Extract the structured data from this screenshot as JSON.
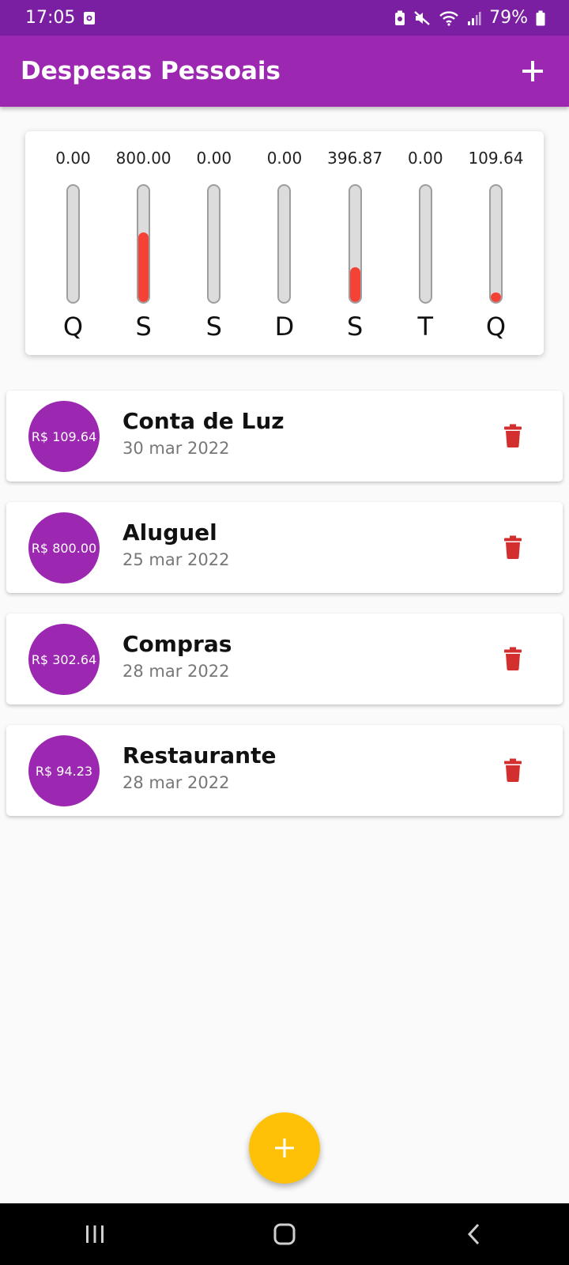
{
  "status_bar": {
    "time": "17:05",
    "battery": "79%",
    "icons": [
      "screen-record-icon",
      "battery-saver-icon",
      "mute-icon",
      "wifi-icon",
      "signal-icon",
      "battery-icon"
    ]
  },
  "app_bar": {
    "title": "Despesas Pessoais",
    "add_icon": "plus-icon"
  },
  "colors": {
    "primary": "#9c27b0",
    "primary_dark": "#7b1fa2",
    "accent": "#ffc107",
    "bar_fill": "#f44336",
    "delete": "#d32f2f"
  },
  "chart_data": {
    "type": "bar",
    "categories": [
      "Q",
      "S",
      "S",
      "D",
      "S",
      "T",
      "Q"
    ],
    "values": [
      0.0,
      800.0,
      0.0,
      0.0,
      396.87,
      0.0,
      109.64
    ],
    "value_labels": [
      "0.00",
      "800.00",
      "0.00",
      "0.00",
      "396.87",
      "0.00",
      "109.64"
    ],
    "fill_fraction": [
      0,
      0.6,
      0,
      0,
      0.3,
      0,
      0.08
    ],
    "ylim": [
      0,
      1306.51
    ]
  },
  "expenses": [
    {
      "amount": "R$ 109.64",
      "title": "Conta de Luz",
      "date": "30 mar 2022"
    },
    {
      "amount": "R$ 800.00",
      "title": "Aluguel",
      "date": "25 mar 2022"
    },
    {
      "amount": "R$ 302.64",
      "title": "Compras",
      "date": "28 mar 2022"
    },
    {
      "amount": "R$ 94.23",
      "title": "Restaurante",
      "date": "28 mar 2022"
    }
  ],
  "fab": {
    "icon": "plus-icon"
  },
  "nav_bar": {
    "icons": [
      "recent-apps-icon",
      "home-icon",
      "back-icon"
    ]
  }
}
